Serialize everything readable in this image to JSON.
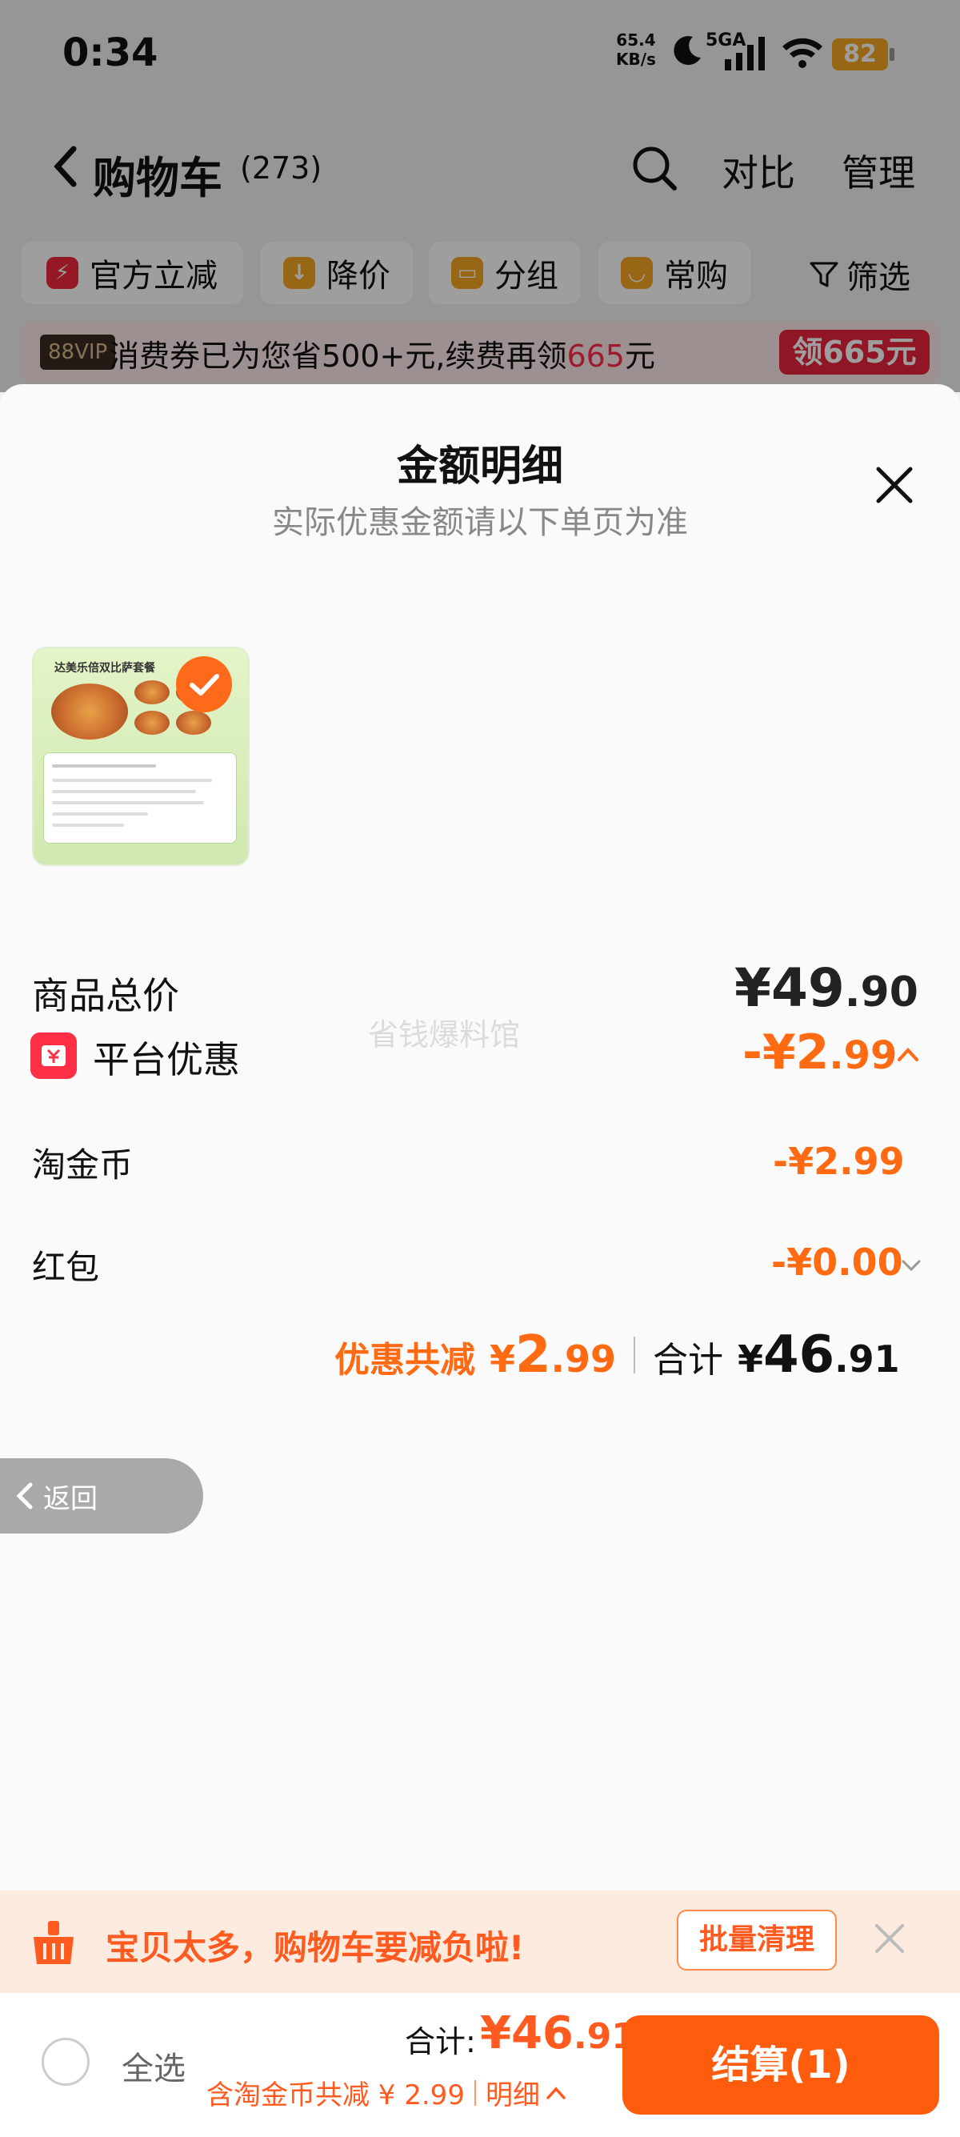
{
  "status": {
    "time": "0:34",
    "net_speed_value": "65.4",
    "net_speed_unit": "KB/s",
    "network": "5GA",
    "battery": "82"
  },
  "header": {
    "title": "购物车",
    "count": "(273)",
    "compare": "对比",
    "manage": "管理"
  },
  "filters": [
    {
      "label": "官方立减",
      "icon": "lightning-icon",
      "color": "#f0283c"
    },
    {
      "label": "降价",
      "icon": "down-arrow-icon",
      "color": "#f5a623"
    },
    {
      "label": "分组",
      "icon": "folder-icon",
      "color": "#f5a623"
    },
    {
      "label": "常购",
      "icon": "bag-icon",
      "color": "#f5a623"
    }
  ],
  "filter_button": "筛选",
  "vip": {
    "tag": "88VIP",
    "text_prefix": "消费券已为您省500+元,续费再领",
    "text_amount": "665",
    "text_suffix": "元",
    "button": "领665元"
  },
  "sheet": {
    "title": "金额明细",
    "subtitle": "实际优惠金额请以下单页为准",
    "product_caption": "达美乐倍双比萨套餐",
    "watermark": "省钱爆料馆",
    "total": {
      "label": "商品总价",
      "currency": "¥",
      "int": "49",
      "dec": ".90"
    },
    "platform": {
      "label": "平台优惠",
      "sign": "-¥",
      "int": "2",
      "dec": ".99"
    },
    "coin": {
      "label": "淘金币",
      "sign": "-¥",
      "int": "2",
      "dec": ".99"
    },
    "redpack": {
      "label": "红包",
      "sign": "-¥",
      "int": "0",
      "dec": ".00"
    },
    "summary": {
      "discount_label": "优惠共减",
      "discount_currency": "¥",
      "discount_int": "2",
      "discount_dec": ".99",
      "total_label": "合计",
      "total_currency": "¥",
      "total_int": "46",
      "total_dec": ".91"
    }
  },
  "back_label": "返回",
  "notice": {
    "text": "宝贝太多，购物车要减负啦!",
    "button": "批量清理"
  },
  "bottom": {
    "select_all": "全选",
    "sum_label": "合计:",
    "sum_currency": "¥",
    "sum_int": "46",
    "sum_dec": ".91",
    "sub_text": "含淘金币共减 ¥ 2.99",
    "detail": "明细",
    "checkout": "结算(1)"
  },
  "colors": {
    "accent": "#ff5c0e",
    "discount": "#ff6a12",
    "vip_red": "#e8233c"
  }
}
